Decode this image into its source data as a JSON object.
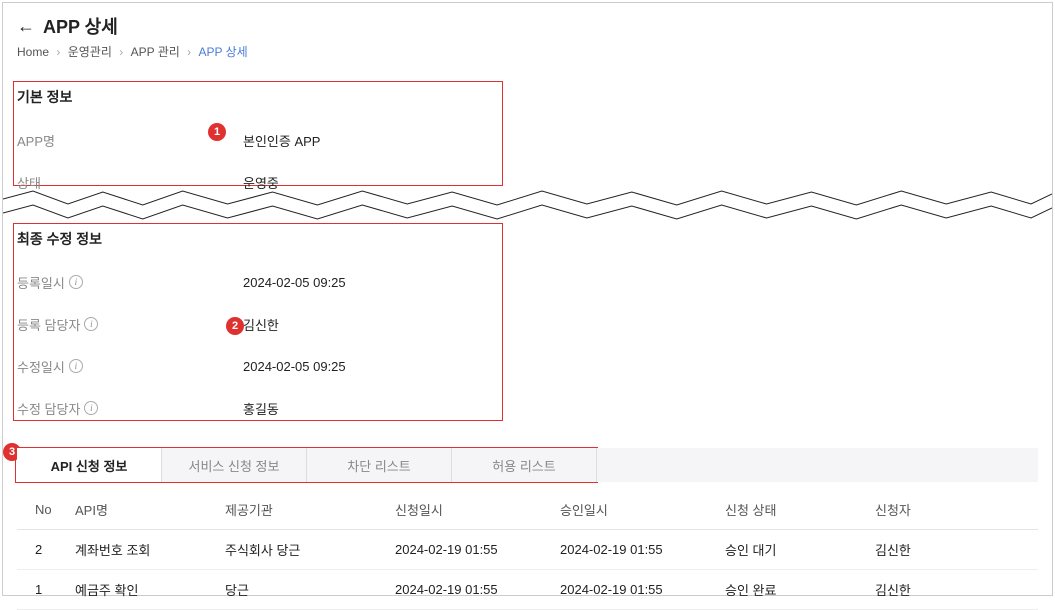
{
  "header": {
    "title": "APP 상세"
  },
  "breadcrumb": {
    "items": [
      "Home",
      "운영관리",
      "APP 관리",
      "APP 상세"
    ]
  },
  "basicInfo": {
    "title": "기본 정보",
    "rows": [
      {
        "label": "APP명",
        "value": "본인인증 APP"
      },
      {
        "label": "상태",
        "value": "운영중"
      }
    ]
  },
  "lastModified": {
    "title": "최종 수정 정보",
    "rows": [
      {
        "label": "등록일시",
        "value": "2024-02-05 09:25",
        "hasIcon": true
      },
      {
        "label": "등록 담당자",
        "value": "김신한",
        "hasIcon": true
      },
      {
        "label": "수정일시",
        "value": "2024-02-05 09:25",
        "hasIcon": true
      },
      {
        "label": "수정 담당자",
        "value": "홍길동",
        "hasIcon": true
      }
    ]
  },
  "tabs": {
    "items": [
      {
        "label": "API 신청 정보",
        "active": true
      },
      {
        "label": "서비스 신청 정보",
        "active": false
      },
      {
        "label": "차단 리스트",
        "active": false
      },
      {
        "label": "허용 리스트",
        "active": false
      }
    ]
  },
  "table": {
    "headers": [
      "No",
      "API명",
      "제공기관",
      "신청일시",
      "승인일시",
      "신청 상태",
      "신청자"
    ],
    "rows": [
      {
        "no": "2",
        "api": "계좌번호 조회",
        "provider": "주식회사 당근",
        "reqDate": "2024-02-19 01:55",
        "appDate": "2024-02-19 01:55",
        "status": "승인 대기",
        "requester": "김신한"
      },
      {
        "no": "1",
        "api": "예금주 확인",
        "provider": "당근",
        "reqDate": "2024-02-19 01:55",
        "appDate": "2024-02-19 01:55",
        "status": "승인 완료",
        "requester": "김신한"
      }
    ]
  },
  "callouts": {
    "one": "1",
    "two": "2",
    "three": "3"
  }
}
